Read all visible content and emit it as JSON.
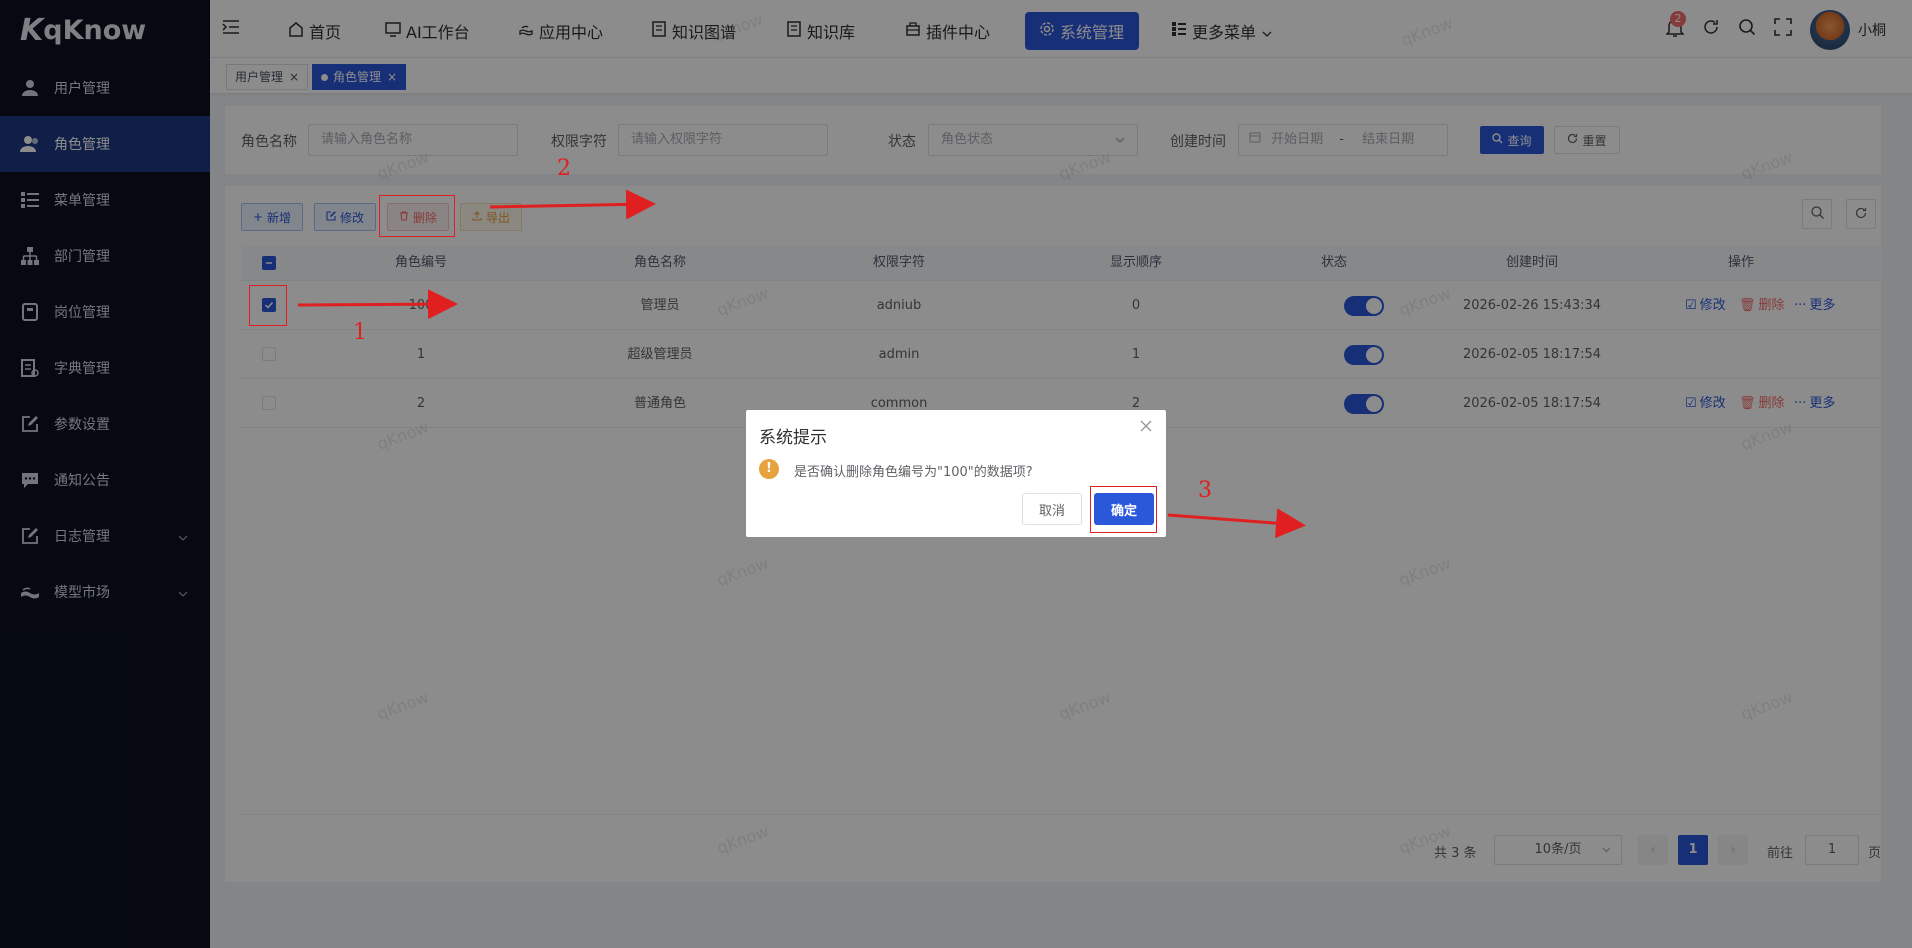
{
  "app": {
    "logo_text": "qKnow",
    "watermark_text": "qKnow"
  },
  "sidebar": {
    "items": [
      {
        "label": "用户管理",
        "icon": "user-icon",
        "active": false
      },
      {
        "label": "角色管理",
        "icon": "users-icon",
        "active": true
      },
      {
        "label": "菜单管理",
        "icon": "tree-list-icon",
        "active": false
      },
      {
        "label": "部门管理",
        "icon": "org-chart-icon",
        "active": false
      },
      {
        "label": "岗位管理",
        "icon": "post-icon",
        "active": false
      },
      {
        "label": "字典管理",
        "icon": "dictionary-icon",
        "active": false
      },
      {
        "label": "参数设置",
        "icon": "edit-icon",
        "active": false
      },
      {
        "label": "通知公告",
        "icon": "message-icon",
        "active": false
      },
      {
        "label": "日志管理",
        "icon": "log-icon",
        "active": false,
        "expandable": true
      },
      {
        "label": "模型市场",
        "icon": "model-icon",
        "active": false,
        "expandable": true
      }
    ]
  },
  "topnav": {
    "items": [
      {
        "label": "首页",
        "icon": "home-icon"
      },
      {
        "label": "AI工作台",
        "icon": "monitor-icon"
      },
      {
        "label": "应用中心",
        "icon": "app-icon"
      },
      {
        "label": "知识图谱",
        "icon": "graph-icon"
      },
      {
        "label": "知识库",
        "icon": "book-icon"
      },
      {
        "label": "插件中心",
        "icon": "plugin-icon"
      },
      {
        "label": "系统管理",
        "icon": "gear-icon",
        "active": true
      },
      {
        "label": "更多菜单",
        "icon": "more-menu-icon"
      }
    ],
    "notification_count": "2",
    "username": "小桐"
  },
  "tags": {
    "items": [
      {
        "label": "用户管理",
        "active": false
      },
      {
        "label": "角色管理",
        "active": true
      }
    ]
  },
  "search": {
    "role_name_label": "角色名称",
    "role_name_placeholder": "请输入角色名称",
    "role_key_label": "权限字符",
    "role_key_placeholder": "请输入权限字符",
    "status_label": "状态",
    "status_placeholder": "角色状态",
    "created_label": "创建时间",
    "start_placeholder": "开始日期",
    "range_separator": "-",
    "end_placeholder": "结束日期",
    "query_button": "查询",
    "reset_button": "重置"
  },
  "toolbar": {
    "add_button": "新增",
    "edit_button": "修改",
    "delete_button": "删除",
    "export_button": "导出"
  },
  "table": {
    "columns": [
      "角色编号",
      "角色名称",
      "权限字符",
      "显示顺序",
      "状态",
      "创建时间",
      "操作"
    ],
    "rows": [
      {
        "id": "100",
        "name": "管理员",
        "key": "adniub",
        "order": "0",
        "enabled": true,
        "created": "2026-02-26 15:43:34",
        "checked": true,
        "has_actions": true
      },
      {
        "id": "1",
        "name": "超级管理员",
        "key": "admin",
        "order": "1",
        "enabled": true,
        "created": "2026-02-05 18:17:54",
        "checked": false,
        "has_actions": false
      },
      {
        "id": "2",
        "name": "普通角色",
        "key": "common",
        "order": "2",
        "enabled": true,
        "created": "2026-02-05 18:17:54",
        "checked": false,
        "has_actions": true
      }
    ],
    "action_edit": "修改",
    "action_delete": "删除",
    "action_more": "更多"
  },
  "pagination": {
    "total_text": "共 3 条",
    "page_size": "10条/页",
    "current_page": "1",
    "goto_label": "前往",
    "goto_value": "1",
    "page_suffix": "页"
  },
  "dialog": {
    "title": "系统提示",
    "message": "是否确认删除角色编号为\"100\"的数据项?",
    "cancel_button": "取消",
    "confirm_button": "确定"
  },
  "annotations": {
    "labels": [
      "1",
      "2",
      "3"
    ],
    "color": "#e02020"
  },
  "colors": {
    "sidebar_bg": "#0b1221",
    "sidebar_active": "#1e3a82",
    "primary": "#2b57d9",
    "danger": "#f56c6c",
    "warning": "#e6a23c"
  }
}
